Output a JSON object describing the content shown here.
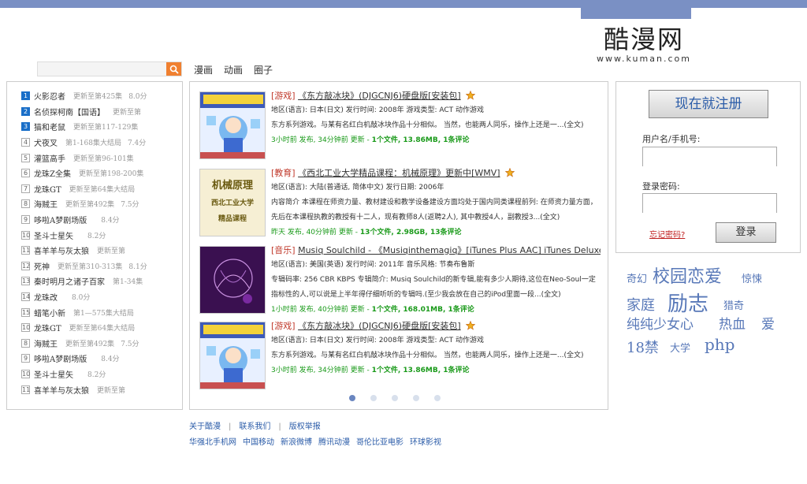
{
  "site": {
    "logo_cn": "酷漫网",
    "logo_en": "www.kuman.com"
  },
  "search": {
    "placeholder": "",
    "icon": "search-icon"
  },
  "nav": [
    "漫画",
    "动画",
    "圈子"
  ],
  "ranking": [
    {
      "num": "1",
      "title": "火影忍者",
      "status": "更新至第425集",
      "score": "8.0分"
    },
    {
      "num": "2",
      "title": "名侦探柯南【国语】",
      "status": "更新至第",
      "score": ""
    },
    {
      "num": "3",
      "title": "猫和老鼠",
      "status": "更新至第117-129集",
      "score": ""
    },
    {
      "num": "4",
      "title": "犬夜叉",
      "status": "第1-168集大结局",
      "score": "7.4分"
    },
    {
      "num": "5",
      "title": "灌篮高手",
      "status": "更新至第96-101集",
      "score": ""
    },
    {
      "num": "6",
      "title": "龙珠Z全集",
      "status": "更新至第198-200集",
      "score": ""
    },
    {
      "num": "7",
      "title": "龙珠GT",
      "status": "更新至第64集大结局",
      "score": ""
    },
    {
      "num": "8",
      "title": "海贼王",
      "status": "更新至第492集",
      "score": "7.5分"
    },
    {
      "num": "9",
      "title": "哆啦A梦剧场版",
      "status": "",
      "score": "8.4分"
    },
    {
      "num": "10",
      "title": "圣斗士星矢",
      "status": "",
      "score": "8.2分"
    },
    {
      "num": "11",
      "title": "喜羊羊与灰太狼",
      "status": "更新至第",
      "score": ""
    },
    {
      "num": "12",
      "title": "死神",
      "status": "更新至第310-313集",
      "score": "8.1分"
    },
    {
      "num": "13",
      "title": "秦时明月之诸子百家",
      "status": "第1-34集",
      "score": ""
    },
    {
      "num": "14",
      "title": "龙珠改",
      "status": "",
      "score": "8.0分"
    },
    {
      "num": "15",
      "title": "蜡笔小新",
      "status": "第1—575集大结局",
      "score": ""
    },
    {
      "num": "10",
      "title": "龙珠GT",
      "status": "更新至第64集大结局",
      "score": ""
    },
    {
      "num": "8",
      "title": "海贼王",
      "status": "更新至第492集",
      "score": "7.5分"
    },
    {
      "num": "9",
      "title": "哆啦A梦剧场版",
      "status": "",
      "score": "8.4分"
    },
    {
      "num": "10",
      "title": "圣斗士星矢",
      "status": "",
      "score": "8.2分"
    },
    {
      "num": "11",
      "title": "喜羊羊与灰太狼",
      "status": "更新至第",
      "score": ""
    }
  ],
  "items": [
    {
      "category": "[游戏]",
      "name": "《东方敲冰块》(DJGCNJ6)硬盘版[安装包]",
      "meta": "地区(语言): 日本(日文) 发行时间: 2008年 游戏类型: ACT 动作游戏",
      "desc": "东方系列游戏。与某有名红白机敲冰块作品十分相似。 当然，也能两人同乐，操作上还是一...(全文)",
      "stats_time": "3小时前 发布, 34分钟前 更新 - ",
      "stats_files": "1个文件, 13.86MB, ",
      "stats_comments": "1条评论",
      "thumb": "game"
    },
    {
      "category": "[教育]",
      "name": "《西北工业大学精品课程：机械原理》更新中[WMV]",
      "meta": "地区(语言): 大陆(普通话, 简体中文) 发行日期: 2006年",
      "desc": "内容简介 本课程在师资力量、教材建设和教学设备建设方面均处于国内同类课程前列: 在师资力量方面，先后在本课程执教的教授有十二人，现有教师8人(返聘2人), 其中教授4人，副教授3...(全文)",
      "stats_time": "昨天 发布, 40分钟前 更新 - ",
      "stats_files": "13个文件, 2.98GB, ",
      "stats_comments": "13条评论",
      "thumb_line1": "机械原理",
      "thumb_line2": "西北工业大学",
      "thumb_line3": "精品课程"
    },
    {
      "category": "[音乐]",
      "name": "Musiq Soulchild - 《Musiqinthemagiq》[iTunes Plus AAC] iTunes Deluxe",
      "meta": "地区(语言): 美国(英语) 发行时间: 2011年 音乐风格: 节奏布鲁斯",
      "desc": "专辑码率: 256 CBR KBPS 专辑简介: Musiq Soulchild的新专辑,能有多少人期待,这位在Neo-Soul一定指标性的人,可以说是上半年得仔细听听的专辑吗.(至少我会放在自己的iPod里面一段...(全文)",
      "stats_time": "1小时前 发布, 40分钟前 更新 - ",
      "stats_files": "1个文件, 168.01MB, ",
      "stats_comments": "1条评论"
    },
    {
      "category": "[游戏]",
      "name": "《东方敲冰块》(DJGCNJ6)硬盘版[安装包]",
      "meta": "地区(语言): 日本(日文) 发行时间: 2008年 游戏类型: ACT 动作游戏",
      "desc": "东方系列游戏。与某有名红白机敲冰块作品十分相似。 当然，也能两人同乐，操作上还是一...(全文)",
      "stats_time": "3小时前 发布, 34分钟前 更新 - ",
      "stats_files": "1个文件, 13.86MB, ",
      "stats_comments": "1条评论"
    }
  ],
  "carousel": {
    "pages": 5,
    "active": 0
  },
  "login": {
    "register_label": "现在就注册",
    "username_label": "用户名/手机号:",
    "password_label": "登录密码:",
    "forgot_label": "忘记密码?",
    "login_label": "登录"
  },
  "tags": [
    "奇幻",
    "校园恋爱",
    "惊悚",
    "家庭",
    "励志",
    "猎奇",
    "纯纯少女心",
    "热血",
    "爱",
    "18禁",
    "大学",
    "php"
  ],
  "footer": {
    "about": "关于酷漫",
    "contact": "联系我们",
    "report": "版权举报",
    "friends": [
      "华强北手机网",
      "中国移动",
      "新浪微博",
      "腾讯动漫",
      "哥伦比亚电影",
      "环球影视"
    ]
  },
  "colors": {
    "accent": "#7a90c4",
    "link": "#2a5ba8",
    "stats": "#1a9a1a",
    "category": "#c0392b"
  }
}
